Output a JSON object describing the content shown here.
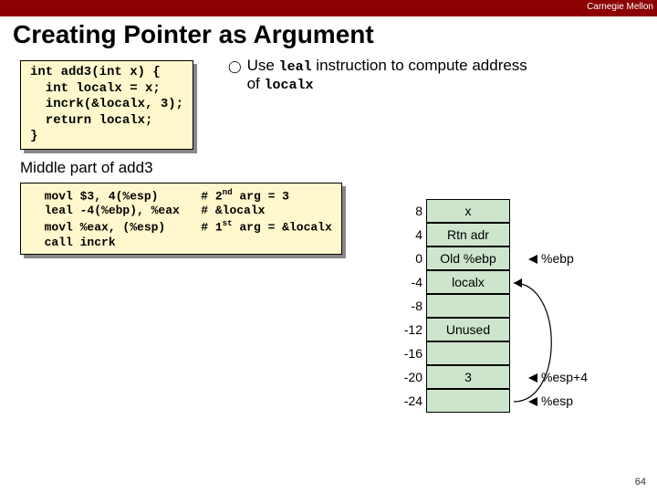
{
  "brand": "Carnegie Mellon",
  "title": "Creating Pointer as Argument",
  "c_code": "int add3(int x) {\n  int localx = x;\n  incrk(&localx, 3);\n  return localx;\n}",
  "bullet": {
    "lead": "Use ",
    "instr": "leal",
    "mid": " instruction to compute address of ",
    "var": "localx"
  },
  "mid_label": "Middle part of add3",
  "asm_lines": [
    {
      "instr": "movl",
      "args": "$3, 4(%esp)",
      "cmt_prefix": "# 2",
      "cmt_ord": "nd",
      "cmt_rest": " arg = 3"
    },
    {
      "instr": "leal",
      "args": "-4(%ebp), %eax",
      "cmt_prefix": "# &localx",
      "cmt_ord": "",
      "cmt_rest": ""
    },
    {
      "instr": "movl",
      "args": "%eax, (%esp)",
      "cmt_prefix": "# 1",
      "cmt_ord": "st",
      "cmt_rest": " arg = &localx"
    },
    {
      "instr": "call",
      "args": "incrk",
      "cmt_prefix": "",
      "cmt_ord": "",
      "cmt_rest": ""
    }
  ],
  "stack": {
    "rows": [
      {
        "off": "8",
        "label": "x",
        "annot": ""
      },
      {
        "off": "4",
        "label": "Rtn adr",
        "annot": ""
      },
      {
        "off": "0",
        "label": "Old %ebp",
        "annot": "%ebp"
      },
      {
        "off": "-4",
        "label": "localx",
        "annot": ""
      },
      {
        "off": "-8",
        "label": "",
        "annot": ""
      },
      {
        "off": "-12",
        "label": "Unused",
        "annot": ""
      },
      {
        "off": "-16",
        "label": "",
        "annot": ""
      },
      {
        "off": "-20",
        "label": "3",
        "annot": "%esp+4"
      },
      {
        "off": "-24",
        "label": "",
        "annot": "%esp"
      }
    ]
  },
  "page_number": "64"
}
